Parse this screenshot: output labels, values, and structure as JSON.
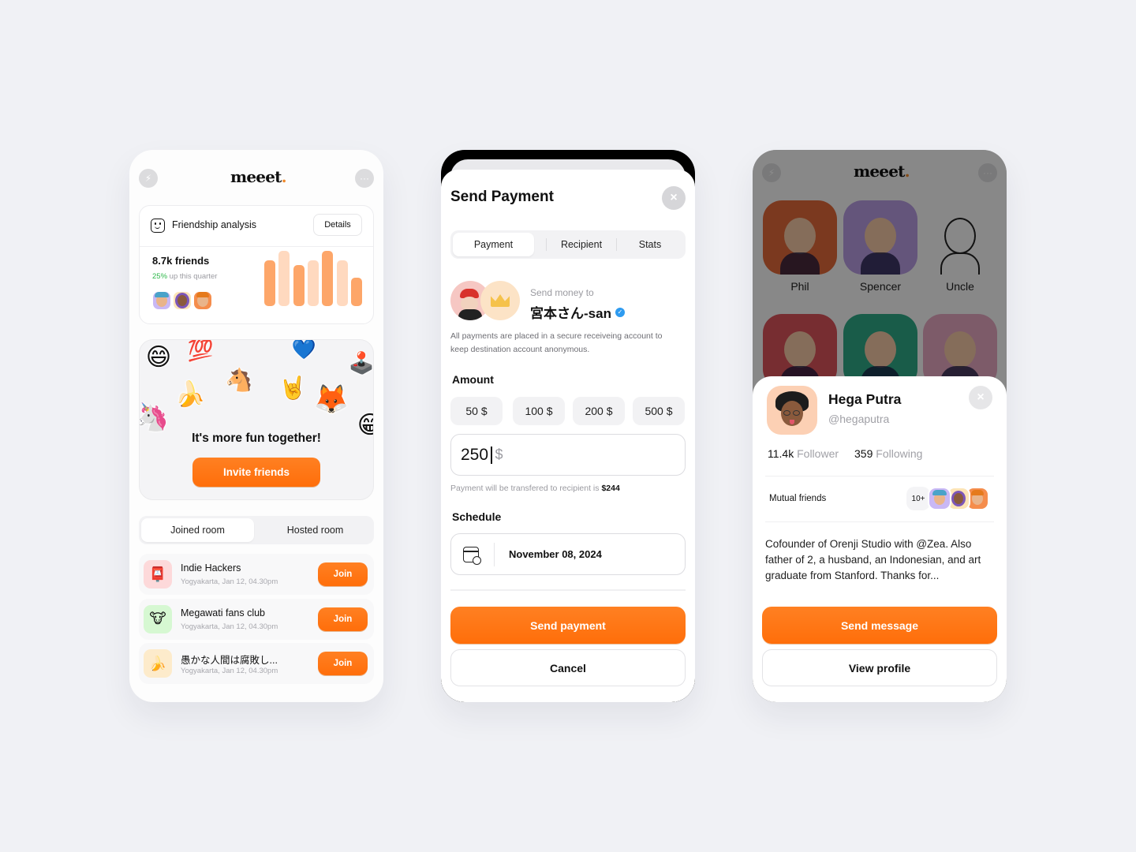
{
  "colors": {
    "accent": "#FF7414",
    "background": "#F0F1F5",
    "bar_dark": "#FDA669",
    "bar_light": "#FFD9BF",
    "positive": "#2DB84A",
    "verified": "#2E9BF0"
  },
  "home": {
    "logo": "meeet",
    "logo_dot": ".",
    "left_icon": "bolt-icon",
    "right_icon": "more-icon",
    "friendship_card": {
      "title": "Friendship analysis",
      "details_label": "Details",
      "friends_count": "8.7k friends",
      "growth_value": "25%",
      "growth_text": "up this quarter",
      "avatars": [
        "friend-avatar-blue-hat",
        "friend-avatar-hijab",
        "friend-avatar-turban"
      ]
    },
    "chart_data": {
      "type": "bar",
      "title": "",
      "categories": [
        "1",
        "2",
        "3",
        "4",
        "5",
        "6",
        "7"
      ],
      "values": [
        83,
        100,
        74,
        83,
        100,
        83,
        52
      ],
      "highlight": [
        true,
        false,
        true,
        false,
        true,
        false,
        true
      ],
      "xlabel": "",
      "ylabel": "",
      "ylim": [
        0,
        100
      ]
    },
    "fun_card": {
      "title": "It's more fun together!",
      "button_label": "Invite friends",
      "stickers": [
        "😄",
        "💯",
        "💙",
        "🕹️",
        "🍌",
        "🦄",
        "🤘",
        "🦊",
        "😁",
        "🐴"
      ]
    },
    "room_tabs": [
      "Joined room",
      "Hosted room"
    ],
    "active_room_tab": 0,
    "rooms": [
      {
        "name": "Indie Hackers",
        "meta": "Yogyakarta, Jan 12,  04.30pm",
        "icon": "📮",
        "icon_bg": "#FDD9DA",
        "button": "Join"
      },
      {
        "name": "Megawati fans club",
        "meta": "Yogyakarta, Jan 12,  04.30pm",
        "icon": "🐮",
        "icon_bg": "#D6F8D2",
        "button": "Join"
      },
      {
        "name": "愚かな人間は腐敗し...",
        "meta": "Yogyakarta, Jan 12,  04.30pm",
        "icon": "🍌",
        "icon_bg": "#FDEBCB",
        "button": "Join"
      }
    ]
  },
  "payment": {
    "title": "Send Payment",
    "close_icon": "×",
    "tabs": [
      "Payment",
      "Recipient",
      "Stats"
    ],
    "active_tab": 0,
    "send_to_label": "Send money to",
    "recipient_name": "宮本さん-san",
    "verified_icon": "✓",
    "note": "All payments are placed in a secure receiveing account to keep destination account anonymous.",
    "amount_label": "Amount",
    "amount_chips": [
      "50 $",
      "100 $",
      "200 $",
      "500 $"
    ],
    "amount_value": "250",
    "amount_currency": "$",
    "transfer_note": "Payment will be transfered to recipient is",
    "transfer_amount": "$244",
    "schedule_label": "Schedule",
    "schedule_date": "November 08, 2024",
    "send_button": "Send payment",
    "cancel_button": "Cancel"
  },
  "profile": {
    "logo": "meeet",
    "logo_dot": ".",
    "tiles": [
      {
        "name": "Phil",
        "bg": "#E0693A"
      },
      {
        "name": "Spencer",
        "bg": "#B79BE0"
      },
      {
        "name": "Uncle",
        "bg": "transparent"
      },
      {
        "name": "",
        "bg": "#D9535A"
      },
      {
        "name": "",
        "bg": "#2FA886"
      },
      {
        "name": "",
        "bg": "#E4A7C0"
      }
    ],
    "name": "Hega Putra",
    "handle": "@hegaputra",
    "followers_value": "11.4k",
    "followers_label": "Follower",
    "following_value": "359",
    "following_label": "Following",
    "mutual_label": "Mutual friends",
    "mutual_count": "10+",
    "bio": "Cofounder of Orenji Studio with @Zea. Also father of 2, a husband, an Indonesian, and art graduate from Stanford. Thanks for...",
    "send_button": "Send message",
    "view_button": "View profile",
    "close_icon": "×"
  }
}
